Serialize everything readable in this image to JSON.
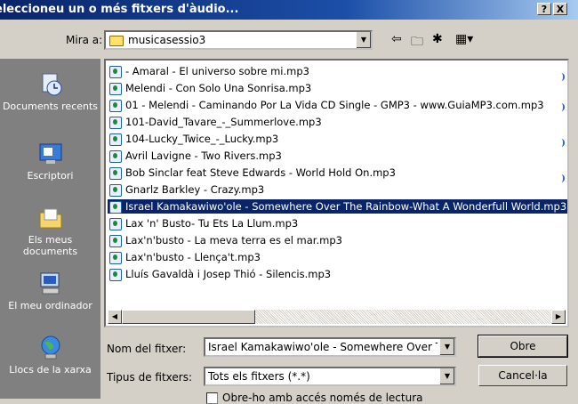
{
  "window": {
    "title": "eleccioneu un o més fitxers d'àudio...",
    "help_button": "?",
    "close_button": "X"
  },
  "toolbar": {
    "look_in_label": "Mira a:",
    "look_in_value": "musicasessio3"
  },
  "places": [
    {
      "label": "Documents recents",
      "icon": "recent-documents-icon"
    },
    {
      "label": "Escriptori",
      "icon": "desktop-icon"
    },
    {
      "label": "Els meus documents",
      "icon": "my-documents-icon"
    },
    {
      "label": "El meu ordinador",
      "icon": "my-computer-icon"
    },
    {
      "label": "Llocs de la xarxa",
      "icon": "network-places-icon"
    }
  ],
  "files": [
    "- Amaral - El universo sobre mi.mp3",
    "Melendi - Con Solo Una Sonrisa.mp3",
    "01 - Melendi - Caminando Por La Vida CD Single - GMP3 - www.GuiaMP3.com.mp3",
    "101-David_Tavare_-_Summerlove.mp3",
    "104-Lucky_Twice_-_Lucky.mp3",
    "Avril Lavigne - Two Rivers.mp3",
    "Bob Sinclar feat Steve Edwards - World Hold On.mp3",
    "Gnarlz Barkley - Crazy.mp3",
    "Israel Kamakawiwo'ole - Somewhere Over The Rainbow-What A Wonderfull World.mp3",
    "Lax 'n' Busto- Tu Ets La Llum.mp3",
    "Lax'n'busto - La meva terra es el mar.mp3",
    "Lax'n'busto - Llença't.mp3",
    "Lluís Gavaldà i Josep Thió - Silencis.mp3"
  ],
  "selected_index": 8,
  "form": {
    "filename_label": "Nom del fitxer:",
    "filename_value": "Israel Kamakawiwo'ole - Somewhere Over The",
    "filetype_label": "Tipus de fitxers:",
    "filetype_value": "Tots els fitxers (*.*)",
    "readonly_label": "Obre-ho amb accés només de lectura",
    "open_button": "Obre",
    "cancel_button": "Cancel·la"
  }
}
